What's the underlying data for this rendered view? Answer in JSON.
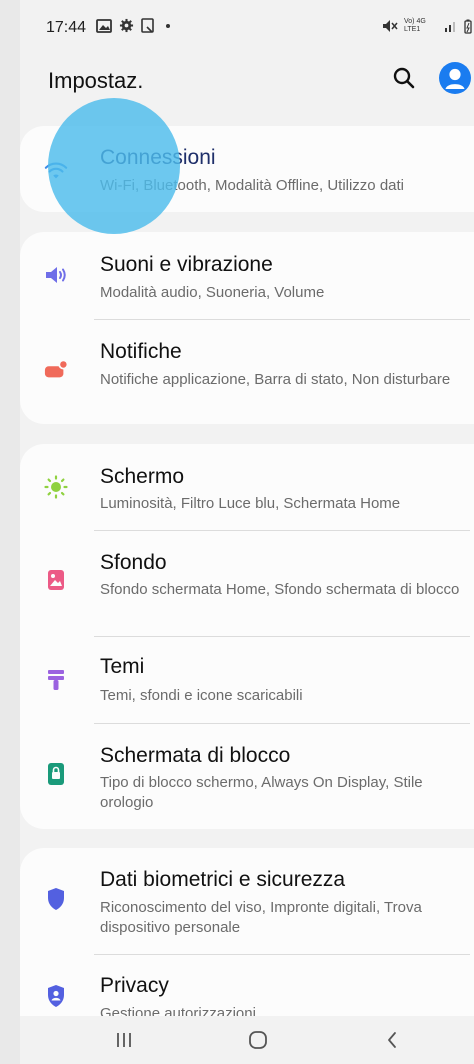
{
  "status_bar": {
    "time": "17:44",
    "signal_label": "Vo) 4G LTE1"
  },
  "header": {
    "title": "Impostaz."
  },
  "sections": [
    {
      "items": [
        {
          "icon": "wifi-icon",
          "label": "Connessioni",
          "sub": "Wi-Fi, Bluetooth, Modalità Offline, Utilizzo dati",
          "label_color": "#1f2f6a"
        }
      ]
    },
    {
      "items": [
        {
          "icon": "volume-icon",
          "label": "Suoni e vibrazione",
          "sub": "Modalità audio, Suoneria, Volume"
        },
        {
          "icon": "notification-icon",
          "label": "Notifiche",
          "sub": "Notifiche applicazione, Barra di stato, Non disturbare"
        }
      ]
    },
    {
      "items": [
        {
          "icon": "brightness-icon",
          "label": "Schermo",
          "sub": "Luminosità, Filtro Luce blu, Schermata Home"
        },
        {
          "icon": "wallpaper-icon",
          "label": "Sfondo",
          "sub": "Sfondo schermata Home, Sfondo schermata di blocco"
        },
        {
          "icon": "themes-icon",
          "label": "Temi",
          "sub": "Temi, sfondi e icone scaricabili"
        },
        {
          "icon": "lock-screen-icon",
          "label": "Schermata di blocco",
          "sub": "Tipo di blocco schermo, Always On Display, Stile orologio"
        }
      ]
    },
    {
      "items": [
        {
          "icon": "biometrics-icon",
          "label": "Dati biometrici e sicurezza",
          "sub": "Riconoscimento del viso, Impronte digitali, Trova dispositivo personale"
        },
        {
          "icon": "privacy-icon",
          "label": "Privacy",
          "sub": "Gestione autorizzazioni"
        }
      ]
    }
  ],
  "colors": {
    "accent": "#1a7cf0",
    "volume": "#6f6ee8",
    "notification": "#f06a5a",
    "brightness": "#8fd13f",
    "wallpaper": "#ec5a86",
    "themes": "#9b62e0",
    "lock_screen": "#1a9a7a",
    "security": "#5360e0",
    "touch_overlay": "#4dbceb"
  },
  "navbar": {
    "recents_icon": "recents-icon",
    "home_icon": "home-icon",
    "back_icon": "back-icon"
  }
}
